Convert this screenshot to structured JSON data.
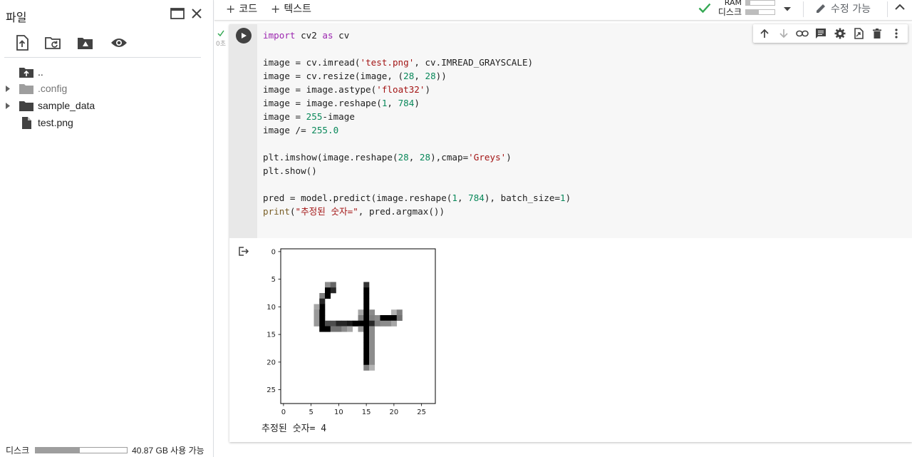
{
  "sidebar": {
    "title": "파일",
    "header_icons": [
      "open-in-window-icon",
      "close-icon"
    ],
    "tools": [
      "upload-icon",
      "refresh-folder-icon",
      "drive-folder-icon",
      "visibility-icon"
    ],
    "tree": [
      {
        "name": "..",
        "type": "parent-folder",
        "expandable": false,
        "dim": false
      },
      {
        "name": ".config",
        "type": "folder",
        "expandable": true,
        "dim": true
      },
      {
        "name": "sample_data",
        "type": "folder",
        "expandable": true,
        "dim": false
      },
      {
        "name": "test.png",
        "type": "file",
        "expandable": false,
        "dim": false
      }
    ],
    "footer": {
      "disk_label": "디스크",
      "disk_used_fraction": 0.48,
      "disk_free_text": "40.87 GB 사용 가능"
    }
  },
  "toolbar": {
    "add_code_label": "코드",
    "add_text_label": "텍스트",
    "ram_label": "RAM",
    "disk_label": "디스크",
    "ram_used_fraction": 0.15,
    "disk_used_fraction": 0.45,
    "edit_mode_label": "수정 가능",
    "accent_color": "#34a853"
  },
  "cell": {
    "exec_time": "0초",
    "code_lines": [
      [
        [
          "kw",
          "import"
        ],
        [
          "t",
          " cv2 "
        ],
        [
          "kw",
          "as"
        ],
        [
          "t",
          " cv"
        ]
      ],
      [],
      [
        [
          "t",
          "image = cv.imread("
        ],
        [
          "str",
          "'test.png'"
        ],
        [
          "t",
          ", cv.IMREAD_GRAYSCALE)"
        ]
      ],
      [
        [
          "t",
          "image = cv.resize(image, ("
        ],
        [
          "num",
          "28"
        ],
        [
          "t",
          ", "
        ],
        [
          "num",
          "28"
        ],
        [
          "t",
          "))"
        ]
      ],
      [
        [
          "t",
          "image = image.astype("
        ],
        [
          "str",
          "'float32'"
        ],
        [
          "t",
          ")"
        ]
      ],
      [
        [
          "t",
          "image = image.reshape("
        ],
        [
          "num",
          "1"
        ],
        [
          "t",
          ", "
        ],
        [
          "num",
          "784"
        ],
        [
          "t",
          ")"
        ]
      ],
      [
        [
          "t",
          "image = "
        ],
        [
          "num",
          "255"
        ],
        [
          "t",
          "-image"
        ]
      ],
      [
        [
          "t",
          "image /= "
        ],
        [
          "num",
          "255.0"
        ]
      ],
      [],
      [
        [
          "t",
          "plt.imshow(image.reshape("
        ],
        [
          "num",
          "28"
        ],
        [
          "t",
          ", "
        ],
        [
          "num",
          "28"
        ],
        [
          "t",
          "),cmap="
        ],
        [
          "str",
          "'Greys'"
        ],
        [
          "t",
          ")"
        ]
      ],
      [
        [
          "t",
          "plt.show()"
        ]
      ],
      [],
      [
        [
          "t",
          "pred = model.predict(image.reshape("
        ],
        [
          "num",
          "1"
        ],
        [
          "t",
          ", "
        ],
        [
          "num",
          "784"
        ],
        [
          "t",
          "), batch_size="
        ],
        [
          "num",
          "1"
        ],
        [
          "t",
          ")"
        ]
      ],
      [
        [
          "fn",
          "print"
        ],
        [
          "t",
          "("
        ],
        [
          "str",
          "\"추정된 숫자=\""
        ],
        [
          "t",
          ", pred.argmax())"
        ]
      ]
    ],
    "cell_toolbar_icons": [
      "arrow-up-icon",
      "arrow-down-icon",
      "link-icon",
      "comment-icon",
      "settings-icon",
      "mirror-cell-icon",
      "delete-icon",
      "more-vert-icon"
    ],
    "output_text": "추정된 숫자= 4"
  },
  "chart_data": {
    "type": "heatmap",
    "colormap": "Greys",
    "shape": [
      28,
      28
    ],
    "xticks": [
      0,
      5,
      10,
      15,
      20,
      25
    ],
    "yticks": [
      0,
      5,
      10,
      15,
      20,
      25
    ],
    "xlim": [
      -0.5,
      27.5
    ],
    "ylim": [
      27.5,
      -0.5
    ],
    "nonzero_pixels": [
      [
        6,
        8,
        0.45
      ],
      [
        6,
        9,
        0.6
      ],
      [
        6,
        15,
        0.8
      ],
      [
        7,
        8,
        1.0
      ],
      [
        7,
        9,
        0.85
      ],
      [
        7,
        15,
        1.0
      ],
      [
        8,
        7,
        0.5
      ],
      [
        8,
        8,
        1.0
      ],
      [
        8,
        15,
        1.0
      ],
      [
        9,
        7,
        0.85
      ],
      [
        9,
        15,
        1.0
      ],
      [
        10,
        7,
        1.0
      ],
      [
        10,
        6,
        0.35
      ],
      [
        10,
        15,
        1.0
      ],
      [
        11,
        6,
        0.4
      ],
      [
        11,
        7,
        1.0
      ],
      [
        11,
        14,
        0.35
      ],
      [
        11,
        15,
        1.0
      ],
      [
        11,
        16,
        0.45
      ],
      [
        11,
        20,
        0.3
      ],
      [
        11,
        21,
        0.5
      ],
      [
        12,
        6,
        0.4
      ],
      [
        12,
        7,
        1.0
      ],
      [
        12,
        14,
        0.5
      ],
      [
        12,
        15,
        1.0
      ],
      [
        12,
        16,
        0.5
      ],
      [
        12,
        17,
        0.45
      ],
      [
        12,
        18,
        1.0
      ],
      [
        12,
        19,
        1.0
      ],
      [
        12,
        20,
        1.0
      ],
      [
        12,
        21,
        0.55
      ],
      [
        13,
        6,
        0.4
      ],
      [
        13,
        7,
        1.0
      ],
      [
        13,
        8,
        0.7
      ],
      [
        13,
        9,
        0.7
      ],
      [
        13,
        10,
        0.85
      ],
      [
        13,
        11,
        0.85
      ],
      [
        13,
        12,
        0.9
      ],
      [
        13,
        13,
        1.0
      ],
      [
        13,
        14,
        1.0
      ],
      [
        13,
        15,
        1.0
      ],
      [
        13,
        16,
        0.85
      ],
      [
        13,
        17,
        0.5
      ],
      [
        13,
        18,
        0.45
      ],
      [
        13,
        19,
        0.45
      ],
      [
        13,
        20,
        0.35
      ],
      [
        14,
        7,
        1.0
      ],
      [
        14,
        8,
        1.0
      ],
      [
        14,
        9,
        0.55
      ],
      [
        14,
        10,
        0.55
      ],
      [
        14,
        11,
        0.45
      ],
      [
        14,
        12,
        0.35
      ],
      [
        14,
        14,
        0.4
      ],
      [
        14,
        15,
        1.0
      ],
      [
        14,
        16,
        0.45
      ],
      [
        15,
        15,
        1.0
      ],
      [
        15,
        16,
        0.45
      ],
      [
        16,
        15,
        1.0
      ],
      [
        16,
        16,
        0.45
      ],
      [
        17,
        15,
        1.0
      ],
      [
        17,
        16,
        0.45
      ],
      [
        18,
        15,
        1.0
      ],
      [
        18,
        16,
        0.45
      ],
      [
        19,
        15,
        1.0
      ],
      [
        19,
        16,
        0.45
      ],
      [
        20,
        15,
        1.0
      ],
      [
        20,
        16,
        0.45
      ],
      [
        21,
        15,
        0.5
      ],
      [
        21,
        16,
        0.3
      ]
    ]
  }
}
